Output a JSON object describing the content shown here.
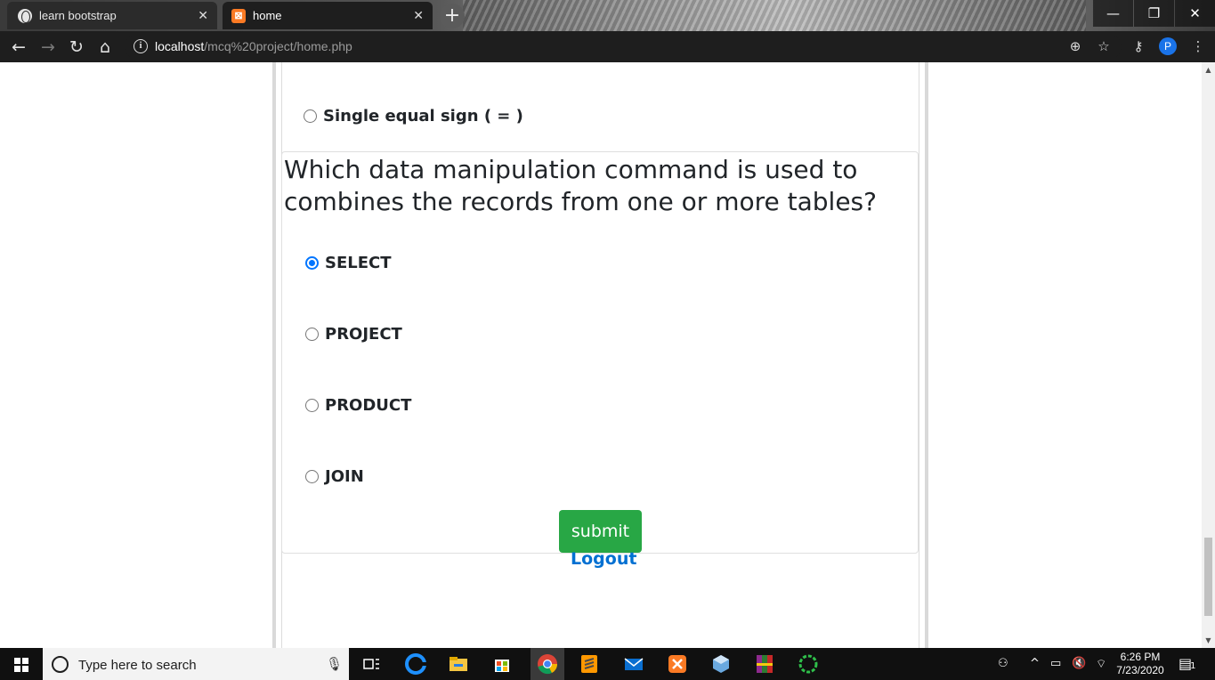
{
  "browser": {
    "tabs": [
      {
        "title": "learn bootstrap",
        "active": false
      },
      {
        "title": "home",
        "active": true
      }
    ],
    "url": {
      "host": "localhost",
      "path": "/mcq%20project/home.php"
    },
    "profile_initial": "P"
  },
  "quiz": {
    "previous_option": "Single equal sign ( = )",
    "question": "Which data manipulation command is used to combines the records from one or more tables?",
    "options": [
      {
        "label": "SELECT",
        "selected": true
      },
      {
        "label": "PROJECT",
        "selected": false
      },
      {
        "label": "PRODUCT",
        "selected": false
      },
      {
        "label": "JOIN",
        "selected": false
      }
    ],
    "submit_label": "submit"
  },
  "logout_label": "Logout",
  "taskbar": {
    "search_placeholder": "Type here to search",
    "time": "6:26 PM",
    "date": "7/23/2020",
    "notification_count": "1"
  },
  "colors": {
    "submit": "#28a745",
    "link": "#0070d2",
    "radio_checked": "#0075ff"
  }
}
